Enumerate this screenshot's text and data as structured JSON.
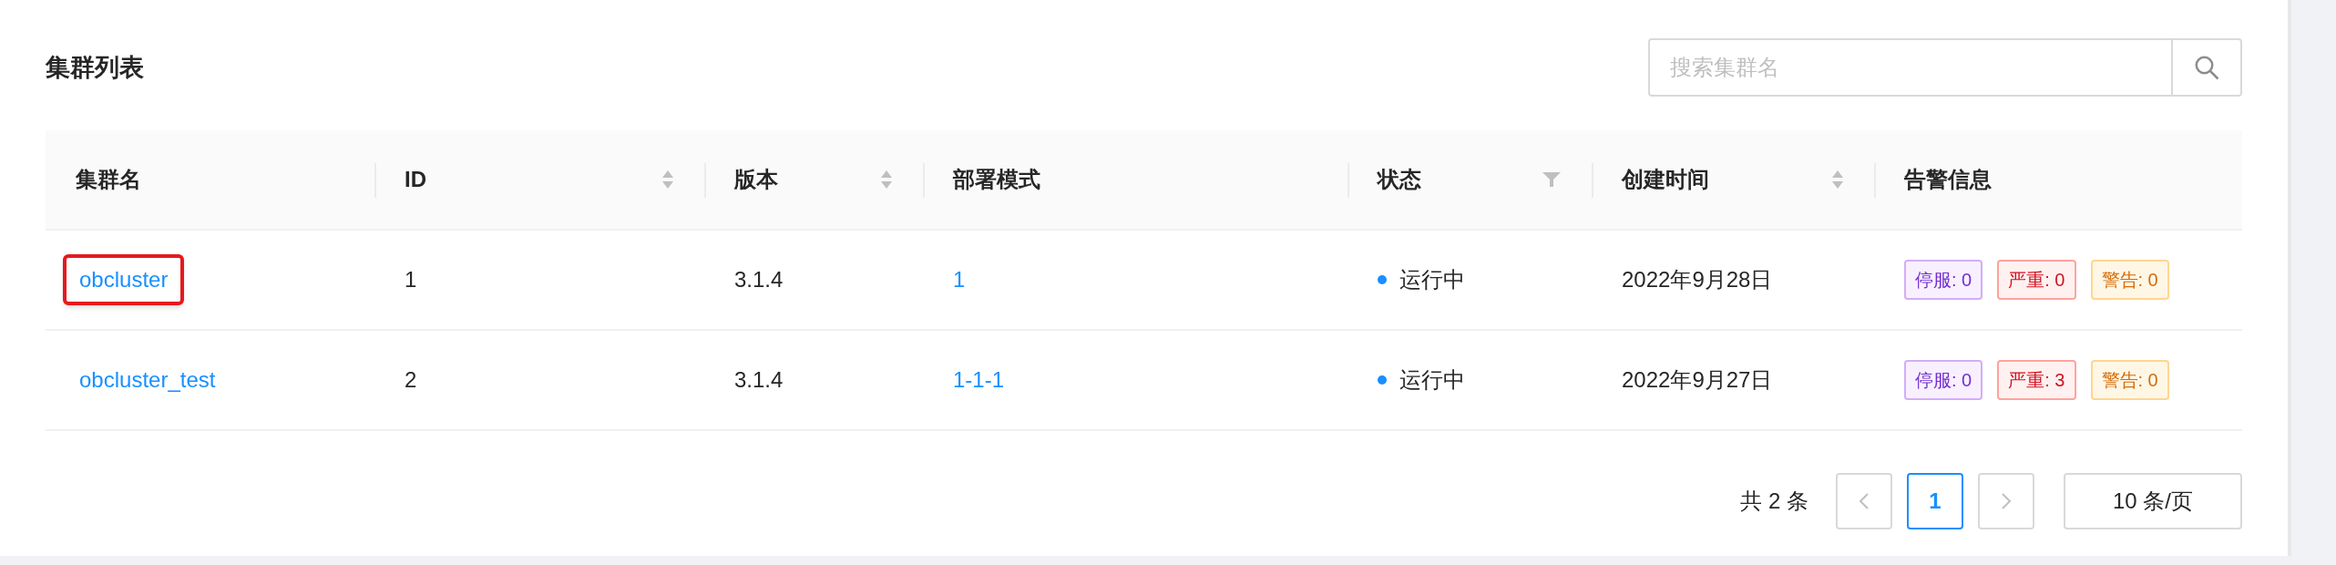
{
  "title": "集群列表",
  "search": {
    "placeholder": "搜索集群名"
  },
  "table": {
    "columns": [
      {
        "label": "集群名",
        "kind": "plain"
      },
      {
        "label": "ID",
        "kind": "sortable"
      },
      {
        "label": "版本",
        "kind": "sortable"
      },
      {
        "label": "部署模式",
        "kind": "plain"
      },
      {
        "label": "状态",
        "kind": "filterable"
      },
      {
        "label": "创建时间",
        "kind": "sortable"
      },
      {
        "label": "告警信息",
        "kind": "plain"
      }
    ],
    "rows": [
      {
        "name": "obcluster",
        "highlighted": true,
        "id": "1",
        "version": "3.1.4",
        "mode": "1",
        "status": {
          "text": "运行中",
          "color": "#1890ff"
        },
        "created": "2022年9月28日",
        "alerts": [
          {
            "text": "停服: 0",
            "kind": "stop"
          },
          {
            "text": "严重: 0",
            "kind": "critical"
          },
          {
            "text": "警告: 0",
            "kind": "warning"
          }
        ]
      },
      {
        "name": "obcluster_test",
        "highlighted": false,
        "id": "2",
        "version": "3.1.4",
        "mode": "1-1-1",
        "status": {
          "text": "运行中",
          "color": "#1890ff"
        },
        "created": "2022年9月27日",
        "alerts": [
          {
            "text": "停服: 0",
            "kind": "stop"
          },
          {
            "text": "严重: 3",
            "kind": "critical"
          },
          {
            "text": "警告: 0",
            "kind": "warning"
          }
        ]
      }
    ]
  },
  "pagination": {
    "total": "共 2 条",
    "pages": [
      {
        "label": "1",
        "selected": true
      }
    ],
    "page_size": "10 条/页"
  }
}
